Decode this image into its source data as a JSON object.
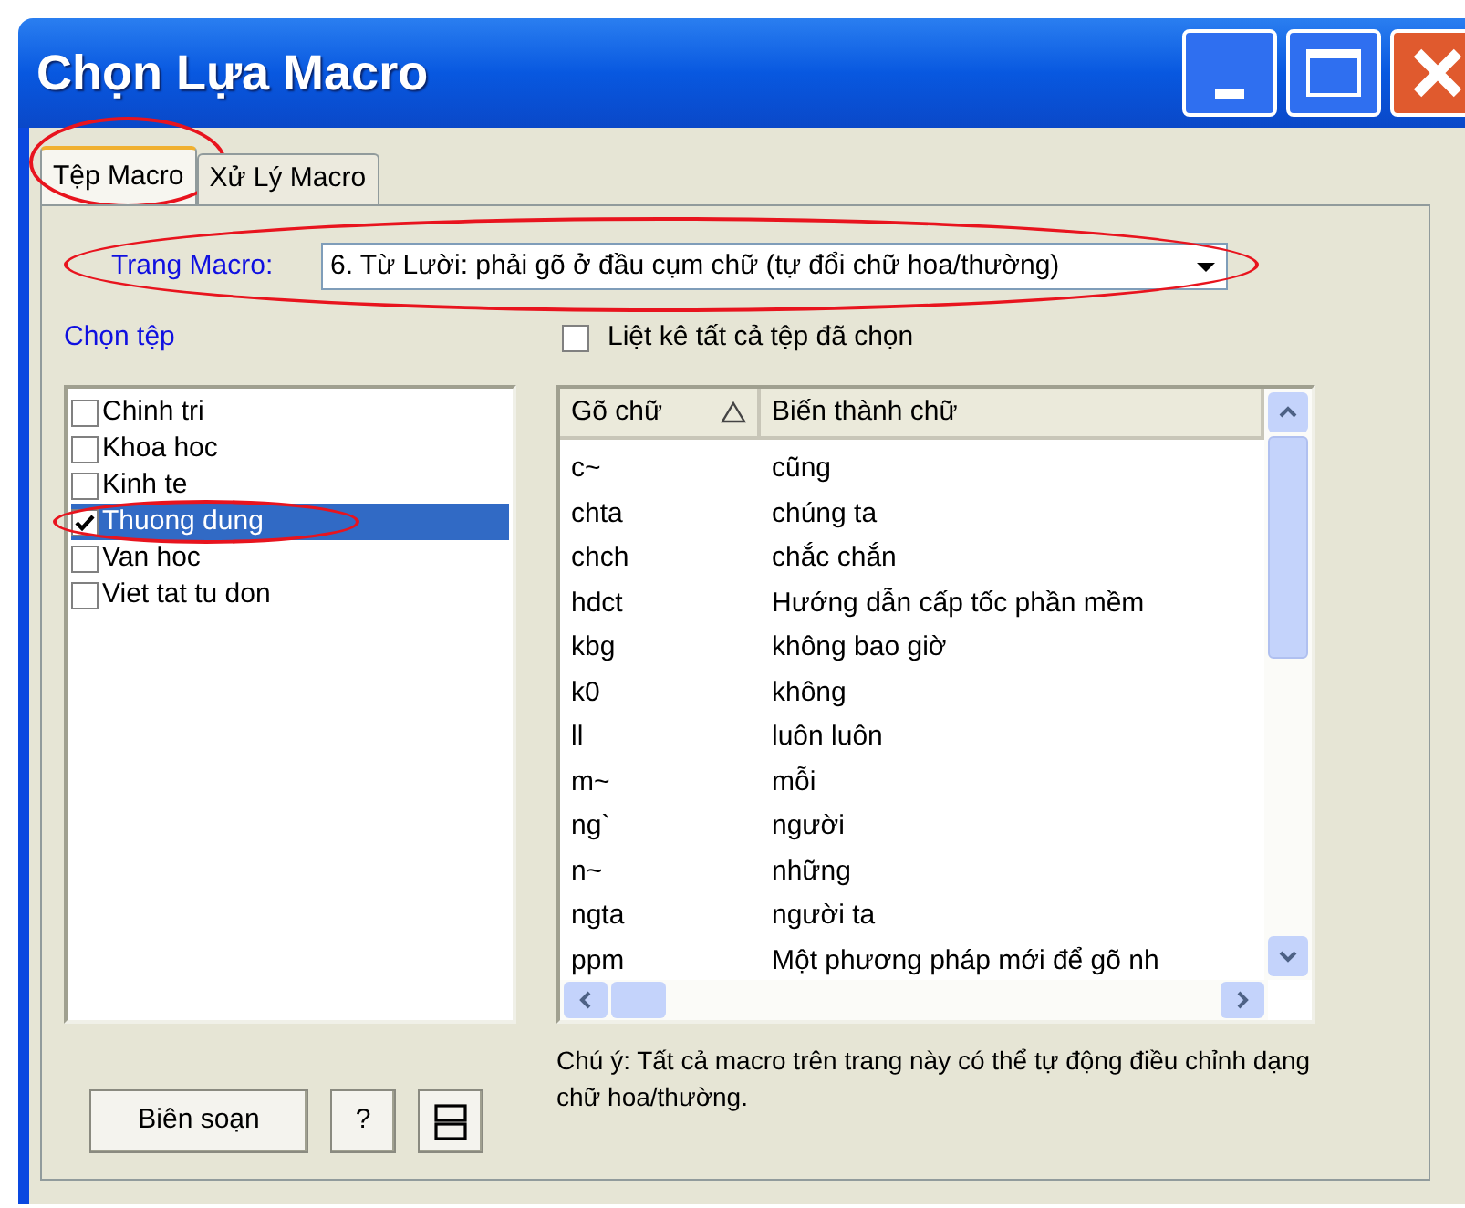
{
  "window": {
    "title": "Chọn Lựa Macro"
  },
  "tabs": [
    {
      "label": "Tệp Macro",
      "selected": true,
      "highlighted": true
    },
    {
      "label": "Xử Lý Macro",
      "selected": false,
      "highlighted": false
    }
  ],
  "macro_page": {
    "label": "Trang Macro:",
    "value": "6. Từ Lười: phải gõ ở đầu cụm chữ (tự đổi chữ hoa/thường)",
    "highlighted": true
  },
  "file_list": {
    "label": "Chọn tệp",
    "items": [
      {
        "label": "Chinh tri",
        "checked": false,
        "selected": false,
        "highlighted": false
      },
      {
        "label": "Khoa hoc",
        "checked": false,
        "selected": false,
        "highlighted": false
      },
      {
        "label": "Kinh te",
        "checked": false,
        "selected": false,
        "highlighted": false
      },
      {
        "label": "Thuong dung",
        "checked": true,
        "selected": true,
        "highlighted": true
      },
      {
        "label": "Van hoc",
        "checked": false,
        "selected": false,
        "highlighted": false
      },
      {
        "label": "Viet tat tu don",
        "checked": false,
        "selected": false,
        "highlighted": false
      }
    ]
  },
  "list_all": {
    "label": "Liệt kê tất cả tệp đã chọn",
    "checked": false
  },
  "table": {
    "columns": [
      {
        "label": "Gõ chữ",
        "sorted": true
      },
      {
        "label": "Biến thành chữ",
        "sorted": false
      }
    ],
    "rows": [
      [
        "c~",
        "cũng"
      ],
      [
        "chta",
        "chúng ta"
      ],
      [
        "chch",
        "chắc chắn"
      ],
      [
        "hdct",
        "Hướng dẫn cấp tốc phần mềm"
      ],
      [
        "kbg",
        "không bao giờ"
      ],
      [
        "k0",
        "không"
      ],
      [
        "ll",
        "luôn luôn"
      ],
      [
        "m~",
        "mỗi"
      ],
      [
        "ng`",
        "người"
      ],
      [
        "n~",
        "những"
      ],
      [
        "ngta",
        "người ta"
      ],
      [
        "ppm",
        "Một phương pháp mới để gõ nh"
      ]
    ]
  },
  "note": "Chú ý: Tất cả macro trên trang này có thể tự động điều chỉnh dạng chữ hoa/thường.",
  "buttons": [
    {
      "kind": "text",
      "label": "Biên soạn"
    },
    {
      "kind": "text",
      "label": "?"
    },
    {
      "kind": "layout"
    }
  ]
}
